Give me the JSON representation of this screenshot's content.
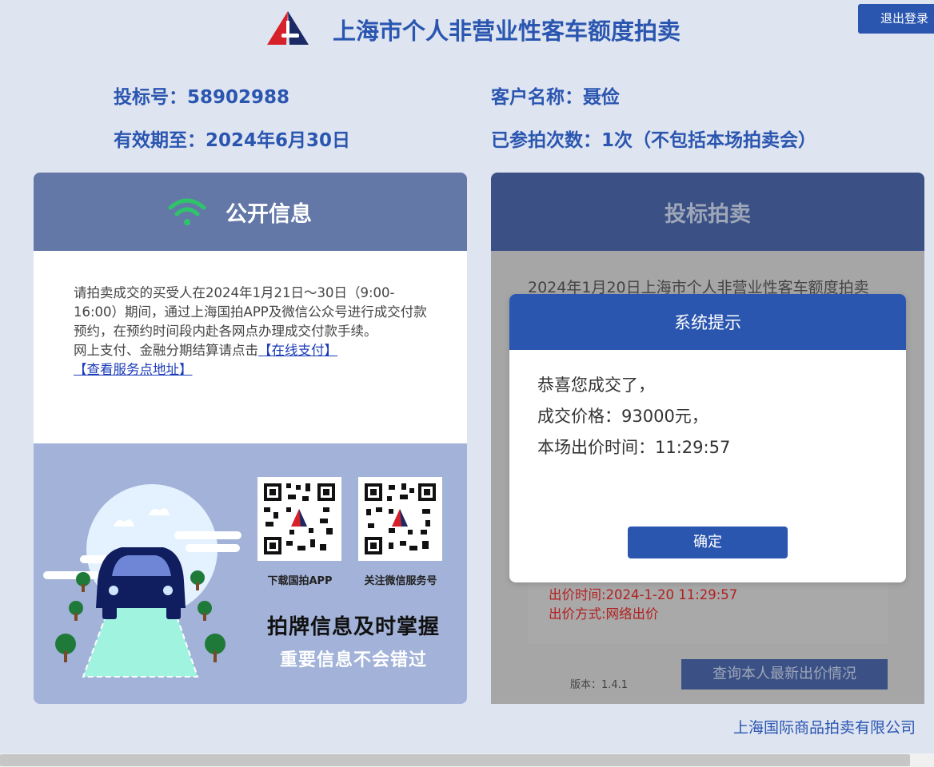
{
  "header": {
    "title": "上海市个人非营业性客车额度拍卖",
    "logout_label": "退出登录"
  },
  "user_info": {
    "bid_number": "投标号：58902988",
    "customer_name": "客户名称：聂俭",
    "valid_until": "有效期至：2024年6月30日",
    "participation_count": "已参拍次数：1次（不包括本场拍卖会）"
  },
  "public_info": {
    "title": "公开信息",
    "notice": "请拍卖成交的买受人在2024年1月21日～30日（9:00-16:00）期间，通过上海国拍APP及微信公众号进行成交付款预约，在预约时间段内赴各网点办理成交付款手续。",
    "online_pay_prefix": "网上支付、金融分期结算请点击",
    "online_pay_link": "【在线支付】",
    "service_link": "【查看服务点地址】",
    "qr_app_caption": "下载国拍APP",
    "qr_wechat_caption": "关注微信服务号",
    "promo_line1": "拍牌信息及时掌握",
    "promo_line2": "重要信息不会错过"
  },
  "bidding": {
    "title": "投标拍卖",
    "auction_text": "2024年1月20日上海市个人非营业性客车额度拍卖",
    "bid_time": "出价时间:2024-1-20 11:29:57",
    "bid_method": "出价方式:网络出价",
    "version": "版本：1.4.1",
    "query_button": "查询本人最新出价情况"
  },
  "modal": {
    "title": "系统提示",
    "line1": "恭喜您成交了，",
    "line2": "成交价格：93000元，",
    "line3": "本场出价时间：11:29:57",
    "ok_label": "确定"
  },
  "footer": {
    "company": "上海国际商品拍卖有限公司"
  },
  "colors": {
    "brand_blue": "#2a56b0",
    "panel_head": "#6478a8",
    "dim_overlay": "#a6a6a6",
    "wifi_green": "#2fc46a"
  }
}
